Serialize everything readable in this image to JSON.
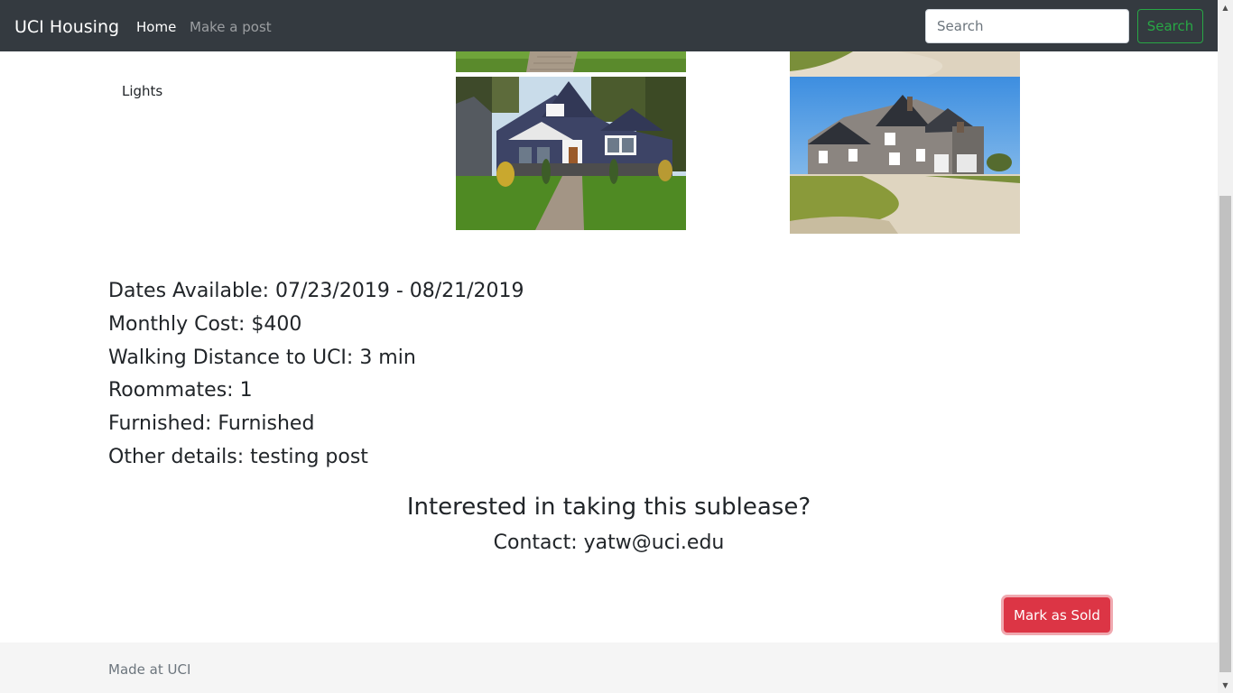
{
  "navbar": {
    "brand": "UCI Housing",
    "links": [
      {
        "label": "Home",
        "active": true
      },
      {
        "label": "Make a post",
        "active": false
      }
    ],
    "search": {
      "placeholder": "Search",
      "button_label": "Search"
    }
  },
  "listing": {
    "amenity": "Lights",
    "details": [
      "Dates Available: 07/23/2019 - 08/21/2019",
      "Monthly Cost: $400",
      "Walking Distance to UCI: 3 min",
      "Roommates: 1",
      "Furnished: Furnished",
      "Other details: testing post"
    ],
    "interest_heading": "Interested in taking this sublease?",
    "contact": "Contact: yatw@uci.edu",
    "mark_sold_label": "Mark as Sold"
  },
  "footer": {
    "text": "Made at UCI"
  },
  "colors": {
    "navbar_bg": "#343a40",
    "search_outline": "#28a745",
    "danger": "#dc3545",
    "footer_bg": "#f5f5f5"
  }
}
